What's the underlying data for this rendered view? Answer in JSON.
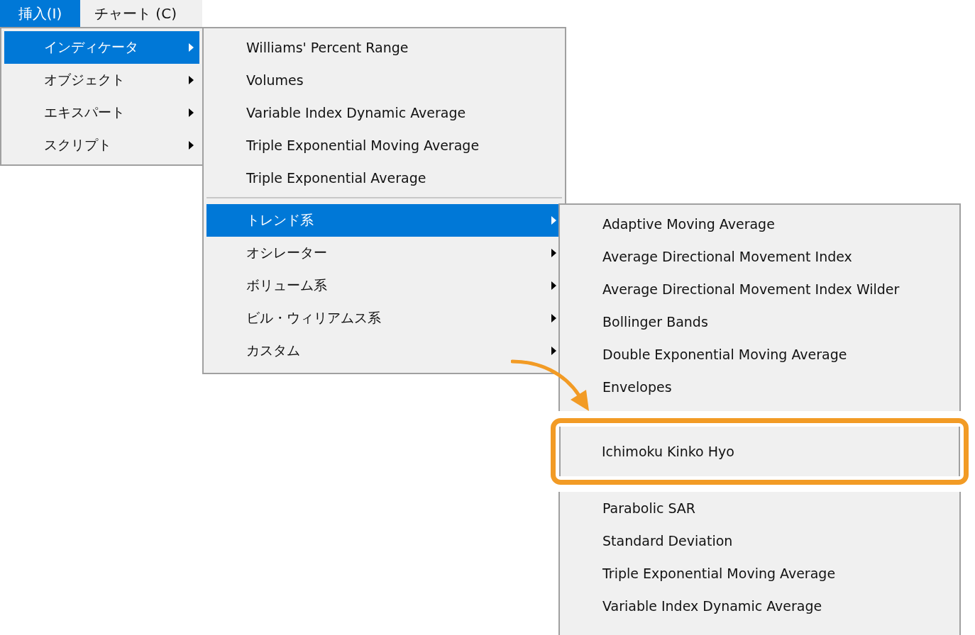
{
  "menubar": [
    {
      "label": "挿入(I)",
      "selected": true
    },
    {
      "label": "チャート (C)",
      "selected": false
    }
  ],
  "insert_menu": [
    {
      "kind": "item",
      "label": "インディケータ",
      "selected": true,
      "submenu": true
    },
    {
      "kind": "item",
      "label": "オブジェクト",
      "selected": false,
      "submenu": true
    },
    {
      "kind": "item",
      "label": "エキスパート",
      "selected": false,
      "submenu": true
    },
    {
      "kind": "item",
      "label": "スクリプト",
      "selected": false,
      "submenu": true
    }
  ],
  "indicators_menu": [
    {
      "kind": "item",
      "label": "Williams' Percent Range",
      "selected": false,
      "submenu": false
    },
    {
      "kind": "item",
      "label": "Volumes",
      "selected": false,
      "submenu": false
    },
    {
      "kind": "item",
      "label": "Variable Index Dynamic Average",
      "selected": false,
      "submenu": false
    },
    {
      "kind": "item",
      "label": "Triple Exponential Moving Average",
      "selected": false,
      "submenu": false
    },
    {
      "kind": "item",
      "label": "Triple Exponential Average",
      "selected": false,
      "submenu": false
    },
    {
      "kind": "separator"
    },
    {
      "kind": "item",
      "label": "トレンド系",
      "selected": true,
      "submenu": true
    },
    {
      "kind": "item",
      "label": "オシレーター",
      "selected": false,
      "submenu": true
    },
    {
      "kind": "item",
      "label": "ボリューム系",
      "selected": false,
      "submenu": true
    },
    {
      "kind": "item",
      "label": "ビル・ウィリアムス系",
      "selected": false,
      "submenu": true
    },
    {
      "kind": "item",
      "label": "カスタム",
      "selected": false,
      "submenu": true
    }
  ],
  "trend_menu": [
    {
      "kind": "item",
      "label": "Adaptive Moving Average",
      "selected": false,
      "submenu": false
    },
    {
      "kind": "item",
      "label": "Average Directional Movement Index",
      "selected": false,
      "submenu": false
    },
    {
      "kind": "item",
      "label": "Average Directional Movement Index Wilder",
      "selected": false,
      "submenu": false
    },
    {
      "kind": "item",
      "label": "Bollinger Bands",
      "selected": false,
      "submenu": false
    },
    {
      "kind": "item",
      "label": "Double Exponential Moving Average",
      "selected": false,
      "submenu": false
    },
    {
      "kind": "item",
      "label": "Envelopes",
      "selected": false,
      "submenu": false
    },
    {
      "kind": "callout",
      "label": "Ichimoku Kinko Hyo",
      "selected": false
    },
    {
      "kind": "item",
      "label": "Parabolic SAR",
      "selected": false,
      "submenu": false
    },
    {
      "kind": "item",
      "label": "Standard Deviation",
      "selected": false,
      "submenu": false
    },
    {
      "kind": "item",
      "label": "Triple Exponential Moving Average",
      "selected": false,
      "submenu": false
    },
    {
      "kind": "item",
      "label": "Variable Index Dynamic Average",
      "selected": false,
      "submenu": false
    }
  ]
}
